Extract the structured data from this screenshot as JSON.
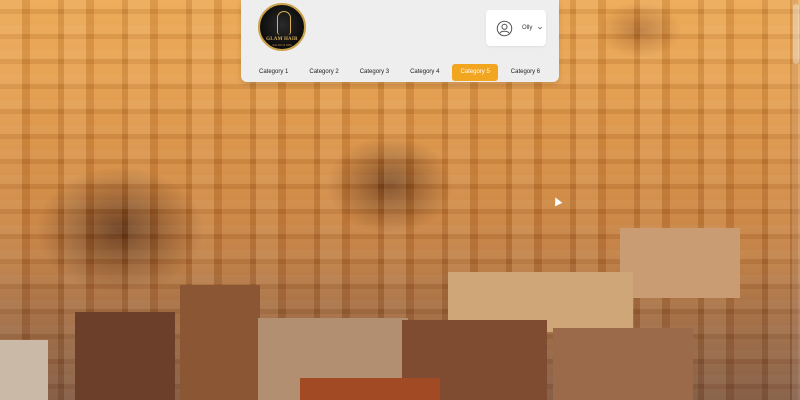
{
  "header": {
    "logo": {
      "icon": "salon-logo",
      "name": "GLAM HAIR",
      "tagline": "SALON & SPA"
    },
    "user": {
      "name": "Olly",
      "avatar_icon": "user-circle-icon",
      "dropdown_icon": "chevron-down-icon"
    },
    "nav": {
      "active_index": 4,
      "items": [
        {
          "label": "Category 1"
        },
        {
          "label": "Category 2"
        },
        {
          "label": "Category 3"
        },
        {
          "label": "Category 4"
        },
        {
          "label": "Category 5"
        },
        {
          "label": "Category 6"
        }
      ]
    }
  },
  "colors": {
    "accent": "#f2a51e",
    "header_bg": "#eeeeee",
    "logo_gold": "#d7b05a"
  }
}
